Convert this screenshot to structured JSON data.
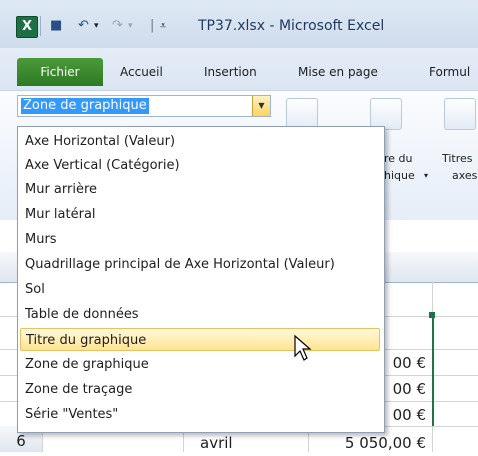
{
  "window": {
    "title": "TP37.xlsx - Microsoft Excel"
  },
  "ribbon": {
    "tabs": [
      "Fichier",
      "Accueil",
      "Insertion",
      "Mise en page",
      "Formul"
    ],
    "selection_box": "Zone de graphique",
    "right_labels": {
      "titre_line1": "re du",
      "titre_line2": "hique",
      "titres_line1": "Titres",
      "titres_line2": "axes"
    }
  },
  "dropdown": {
    "items": [
      "Axe Horizontal (Valeur)",
      "Axe Vertical (Catégorie)",
      "Mur arrière",
      "Mur latéral",
      "Murs",
      "Quadrillage principal de Axe Horizontal (Valeur)",
      "Sol",
      "Table de données",
      "Titre du graphique",
      "Zone de graphique",
      "Zone de traçage",
      "Série \"Ventes\""
    ],
    "highlighted": "Titre du graphique"
  },
  "sheet": {
    "values": [
      "00 €",
      "00 €",
      "00 €"
    ],
    "row6": {
      "number": "6",
      "label": "avril",
      "value": "5 050,00 €"
    }
  }
}
